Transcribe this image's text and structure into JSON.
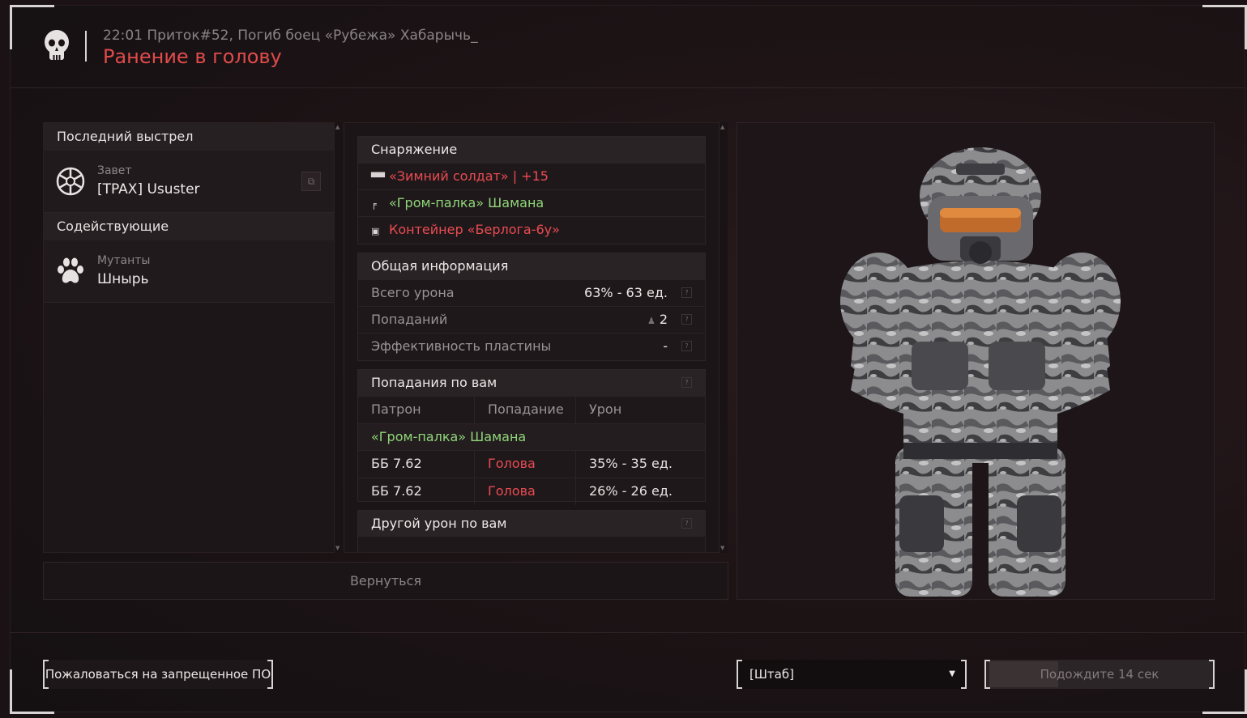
{
  "header": {
    "subtitle": "22:01 Приток#52, Погиб боец «Рубежа» Хабарычь_",
    "title": "Ранение в голову"
  },
  "last_shot": {
    "heading": "Последний выстрел",
    "faction": "Завет",
    "player": "[TPAX] Ususter"
  },
  "assists": {
    "heading": "Содействующие",
    "faction": "Мутанты",
    "name": "Шнырь"
  },
  "equipment": {
    "heading": "Снаряжение",
    "items": [
      {
        "name": "«Зимний солдат» | +15",
        "color": "#e84c53",
        "icon": "armor-icon"
      },
      {
        "name": "«Гром-палка» Шамана",
        "color": "#8fd67a",
        "icon": "pistol-icon"
      },
      {
        "name": "Контейнер «Берлога-6у»",
        "color": "#e84c53",
        "icon": "container-icon"
      }
    ]
  },
  "general": {
    "heading": "Общая информация",
    "rows": [
      {
        "label": "Всего урона",
        "value": "63% - 63 ед."
      },
      {
        "label": "Попаданий",
        "value": "2"
      },
      {
        "label": "Эффективность пластины",
        "value": "-"
      }
    ]
  },
  "hits": {
    "heading": "Попадания по вам",
    "columns": [
      "Патрон",
      "Попадание",
      "Урон"
    ],
    "weapon": "«Гром-палка» Шамана",
    "rows": [
      {
        "ammo": "ББ 7.62",
        "hit": "Голова",
        "damage": "35% - 35 ед."
      },
      {
        "ammo": "ББ 7.62",
        "hit": "Голова",
        "damage": "26% - 26 ед."
      }
    ]
  },
  "other_damage": {
    "heading": "Другой урон по вам"
  },
  "back_button": "Вернуться",
  "report_button": "Пожаловаться на запрещенное ПО",
  "select": {
    "value": "[Штаб]"
  },
  "wait_button": {
    "label": "Подождите 14 сек",
    "progress": 0.3
  },
  "colors": {
    "accent_red": "#e04b4b",
    "item_green": "#8fd67a",
    "item_red": "#e84c53"
  }
}
